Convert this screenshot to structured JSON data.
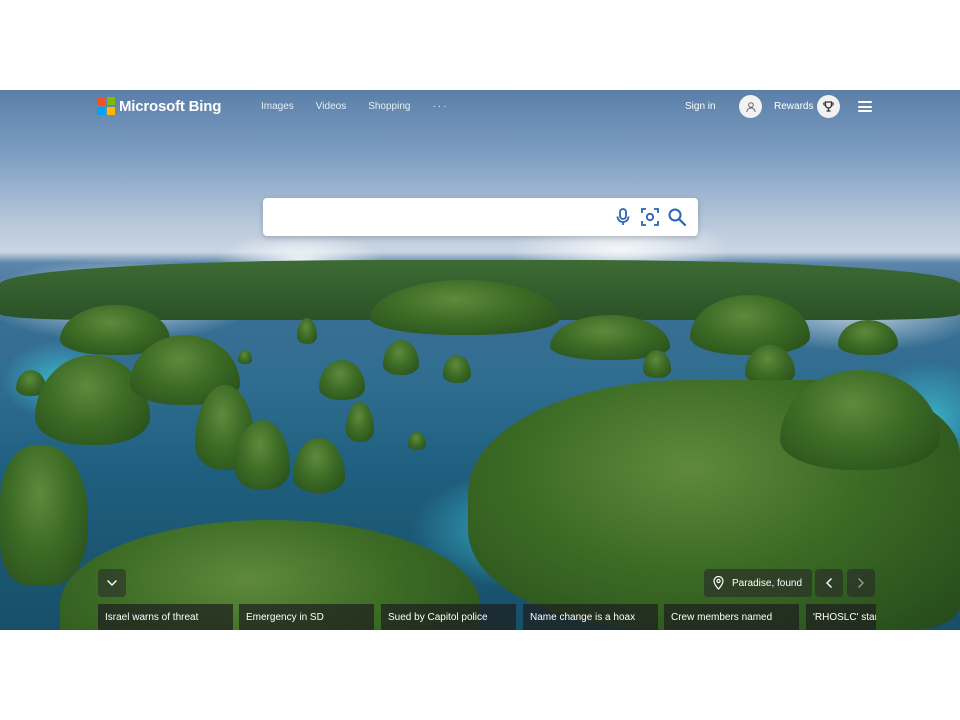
{
  "brand": {
    "name": "Microsoft Bing",
    "logo_colors": [
      "#f25022",
      "#7fba00",
      "#00a4ef",
      "#ffb900"
    ]
  },
  "nav": {
    "items": [
      "Images",
      "Videos",
      "Shopping"
    ],
    "more_label": "···"
  },
  "account": {
    "signin_label": "Sign in",
    "rewards_label": "Rewards"
  },
  "search": {
    "value": "",
    "placeholder": "",
    "icons": [
      "microphone-icon",
      "visual-search-icon",
      "search-icon"
    ]
  },
  "image": {
    "caption": "Paradise, found"
  },
  "news": [
    "Israel warns of threat",
    "Emergency in SD",
    "Sued by Capitol police",
    "Name change is a hoax",
    "Crew members named",
    "'RHOSLC' star"
  ],
  "colors": {
    "accent_blue": "#2764b4",
    "overlay": "#282828"
  }
}
